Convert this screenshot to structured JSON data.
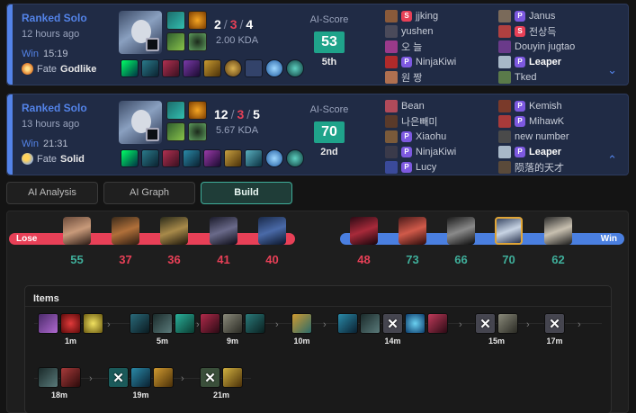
{
  "matches": [
    {
      "queue": "Ranked Solo",
      "time_ago": "12 hours ago",
      "result": "Win",
      "duration": "15:19",
      "fate_label": "Fate",
      "fate_value": "Godlike",
      "kills": "2",
      "deaths": "3",
      "assists": "4",
      "kda_ratio": "2.00 KDA",
      "ai_label": "AI-Score",
      "ai_score": "53",
      "placement": "5th",
      "team1": [
        {
          "name": "jjking",
          "tag": "S"
        },
        {
          "name": "yushen",
          "tag": ""
        },
        {
          "name": "오 늘",
          "tag": ""
        },
        {
          "name": "NinjaKiwi",
          "tag": "P"
        },
        {
          "name": "원 짱",
          "tag": ""
        }
      ],
      "team2": [
        {
          "name": "Janus",
          "tag": "P"
        },
        {
          "name": "전상득",
          "tag": "S"
        },
        {
          "name": "Douyin jugtao",
          "tag": ""
        },
        {
          "name": "Leaper",
          "tag": "P",
          "me": true
        },
        {
          "name": "Tked",
          "tag": ""
        }
      ],
      "toggle": "⌄"
    },
    {
      "queue": "Ranked Solo",
      "time_ago": "13 hours ago",
      "result": "Win",
      "duration": "21:31",
      "fate_label": "Fate",
      "fate_value": "Solid",
      "kills": "12",
      "deaths": "3",
      "assists": "5",
      "kda_ratio": "5.67 KDA",
      "ai_label": "AI-Score",
      "ai_score": "70",
      "placement": "2nd",
      "team1": [
        {
          "name": "Bean",
          "tag": ""
        },
        {
          "name": "나은빼미",
          "tag": ""
        },
        {
          "name": "Xiaohu",
          "tag": "P"
        },
        {
          "name": "NinjaKiwi",
          "tag": "P"
        },
        {
          "name": "Lucy",
          "tag": "P"
        }
      ],
      "team2": [
        {
          "name": "Kemish",
          "tag": "P"
        },
        {
          "name": "MihawK",
          "tag": "P"
        },
        {
          "name": "new number",
          "tag": ""
        },
        {
          "name": "Leaper",
          "tag": "P",
          "me": true
        },
        {
          "name": "陨落的天才",
          "tag": ""
        }
      ],
      "toggle": "⌃"
    }
  ],
  "tabs": [
    "AI Analysis",
    "AI Graph",
    "Build"
  ],
  "active_tab": "Build",
  "build": {
    "lose_label": "Lose",
    "win_label": "Win",
    "lose_scores": [
      "55",
      "37",
      "36",
      "41",
      "40"
    ],
    "win_scores": [
      "48",
      "73",
      "66",
      "70",
      "62"
    ],
    "items_title": "Items",
    "timeline": [
      {
        "time": "1m"
      },
      {
        "time": "5m"
      },
      {
        "time": "9m"
      },
      {
        "time": "10m"
      },
      {
        "time": "14m"
      },
      {
        "time": "15m"
      },
      {
        "time": "17m"
      },
      {
        "time": "18m"
      },
      {
        "time": "19m"
      },
      {
        "time": "21m"
      }
    ]
  },
  "colors": {
    "win_blue": "#5383e8",
    "lose_red": "#e84057",
    "ai_green": "#1fa38a",
    "accent_teal": "#3fae9a"
  }
}
